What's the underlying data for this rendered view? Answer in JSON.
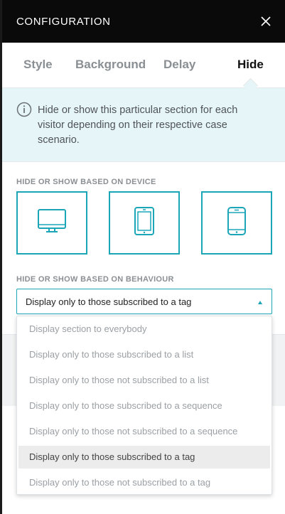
{
  "header": {
    "title": "CONFIGURATION",
    "close_icon": "close-icon"
  },
  "tabs": [
    {
      "label": "Style",
      "active": false
    },
    {
      "label": "Background",
      "active": false
    },
    {
      "label": "Delay",
      "active": false
    },
    {
      "label": "Hide",
      "active": true
    }
  ],
  "info": {
    "icon": "info-icon",
    "text": "Hide or show this particular section for each visitor depending on their respective case scenario."
  },
  "device_section": {
    "label": "HIDE OR SHOW BASED ON DEVICE",
    "devices": [
      {
        "name": "desktop",
        "icon": "desktop-icon"
      },
      {
        "name": "tablet",
        "icon": "tablet-icon"
      },
      {
        "name": "mobile",
        "icon": "mobile-icon"
      }
    ]
  },
  "behaviour_section": {
    "label": "HIDE OR SHOW BASED ON BEHAVIOUR",
    "selected": "Display only to those subscribed to a tag",
    "options": [
      "Display section to everybody",
      "Display only to those subscribed to a list",
      "Display only to those not subscribed to a list",
      "Display only to those subscribed to a sequence",
      "Display only to those not subscribed to a sequence",
      "Display only to those subscribed to a tag",
      "Display only to those not subscribed to a tag"
    ],
    "selected_index": 5
  },
  "colors": {
    "accent": "#1ba6b8",
    "header_bg": "#0a0a0a",
    "info_bg": "#e6f6f8"
  }
}
